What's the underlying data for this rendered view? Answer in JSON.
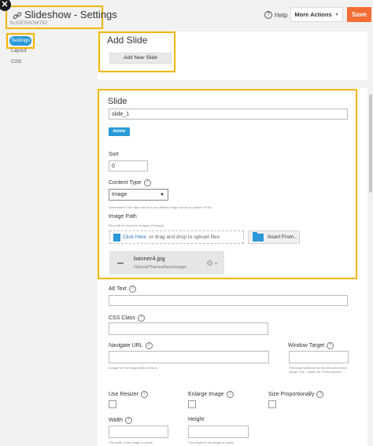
{
  "window": {
    "close_glyph": "✕"
  },
  "header": {
    "title": "Slideshow - Settings",
    "subtitle": "SLIDESHOW792",
    "help_label": "Help",
    "more_actions_label": "More Actions",
    "save_label": "Save"
  },
  "sidebar": {
    "items": [
      {
        "label": "Settings",
        "active": true
      },
      {
        "label": "Layout"
      },
      {
        "label": "CSS"
      }
    ]
  },
  "add_slide": {
    "title": "Add Slide",
    "button_label": "Add New Slide"
  },
  "slide": {
    "title": "Slide",
    "name_value": "slide_1",
    "delete_label": "delete",
    "sort_label": "Sort",
    "sort_value": "0",
    "content_type_label": "Content Type",
    "content_type_value": "Image",
    "content_type_hint": "Determines if the slide will be a pre-defined image format or custom HTML",
    "image_path_label": "Image Path",
    "image_path_hint": "Files will be stored to /images [Change]",
    "upload_click_here": "Click Here",
    "upload_text": "or drag and drop to upload files",
    "from_button": "Insert From...",
    "file_name": "banner4.jpg",
    "file_path": "/Shared/Themes/Base/images"
  },
  "fields": {
    "alt_text_label": "Alt Text",
    "css_class_label": "CSS Class",
    "navigate_url_label": "Navigate URL",
    "navigate_url_hint": "A page for the image slide to link to.",
    "window_target_label": "Window Target",
    "window_target_hint": "The target attribute for the link around the image. Use '_blank' for a new window.",
    "use_resizer_label": "Use Resizer",
    "enlarge_image_label": "Enlarge Image",
    "size_proportionally_label": "Size Proportionally",
    "width_label": "Width",
    "width_hint": "The width of the image in pixels",
    "height_label": "Height",
    "height_hint": "The height of the image in pixels"
  },
  "colors": {
    "accent": "#2b98d8",
    "save": "#f36d34",
    "highlight": "#f5b400"
  }
}
